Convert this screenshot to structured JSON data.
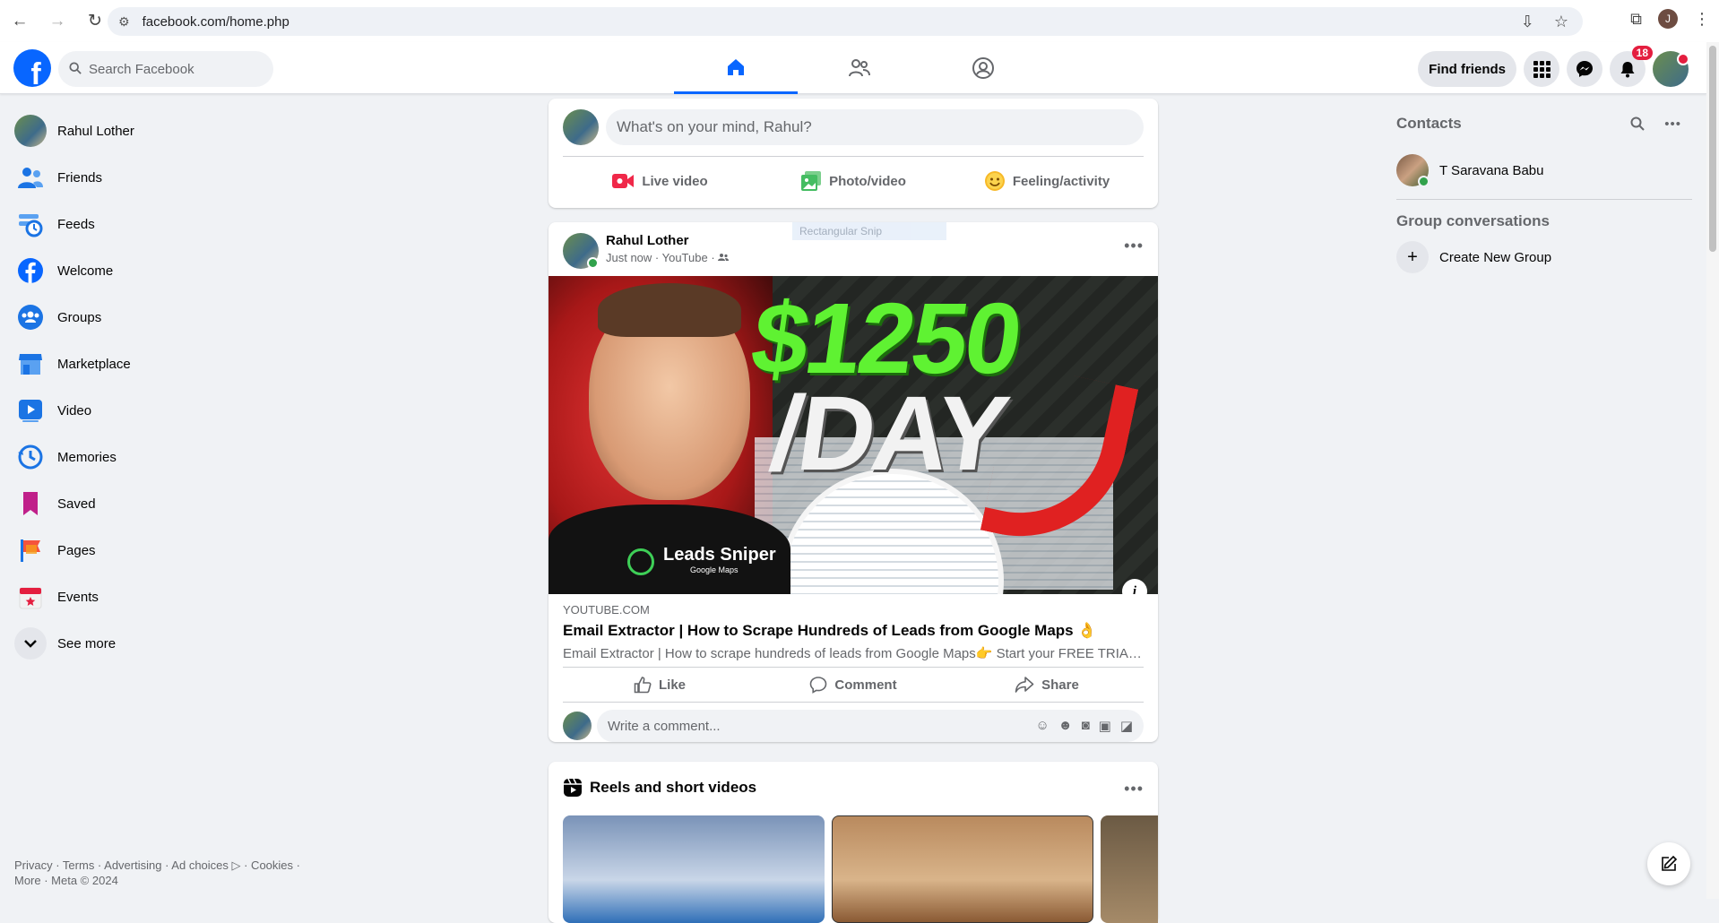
{
  "browser": {
    "url": "facebook.com/home.php",
    "profile_initial": "J"
  },
  "fb": {
    "logo": "f",
    "search_placeholder": "Search Facebook",
    "find_friends": "Find friends",
    "notif_count": "18",
    "nav_tabs": [
      "home-icon",
      "friends-icon",
      "groups-icon"
    ]
  },
  "sidebar": {
    "items": [
      {
        "label": "Rahul Lother",
        "icon": "avatar"
      },
      {
        "label": "Friends",
        "icon": "friends-icon"
      },
      {
        "label": "Feeds",
        "icon": "feeds-icon"
      },
      {
        "label": "Welcome",
        "icon": "facebook-icon"
      },
      {
        "label": "Groups",
        "icon": "groups-icon"
      },
      {
        "label": "Marketplace",
        "icon": "marketplace-icon"
      },
      {
        "label": "Video",
        "icon": "video-icon"
      },
      {
        "label": "Memories",
        "icon": "memories-icon"
      },
      {
        "label": "Saved",
        "icon": "saved-icon"
      },
      {
        "label": "Pages",
        "icon": "pages-icon"
      },
      {
        "label": "Events",
        "icon": "events-icon"
      },
      {
        "label": "See more",
        "icon": "chevron-down-icon"
      }
    ],
    "footer_line1": "Privacy · Terms · Advertising · Ad choices ▷ · Cookies ·",
    "footer_line2": "More · Meta © 2024"
  },
  "composer": {
    "placeholder": "What's on your mind, Rahul?",
    "live": "Live video",
    "photo": "Photo/video",
    "feeling": "Feeling/activity"
  },
  "post": {
    "author": "Rahul Lother",
    "meta": "Just now · YouTube ·",
    "snip_overlay": "Rectangular Snip",
    "thumb_amount": "$1250",
    "thumb_day": "/DAY",
    "thumb_brand": "Leads Sniper",
    "thumb_brand_sub": "Google Maps",
    "domain": "YOUTUBE.COM",
    "title": "Email Extractor | How to Scrape Hundreds of Leads from Google Maps 👌",
    "description": "Email Extractor | How to scrape hundreds of leads from Google Maps👉 Start your FREE TRIAL ...",
    "like": "Like",
    "comment": "Comment",
    "share": "Share",
    "comment_placeholder": "Write a comment..."
  },
  "reels": {
    "title": "Reels and short videos"
  },
  "right": {
    "contacts_title": "Contacts",
    "contact_name": "T Saravana Babu",
    "groups_title": "Group conversations",
    "create_group": "Create New Group"
  }
}
